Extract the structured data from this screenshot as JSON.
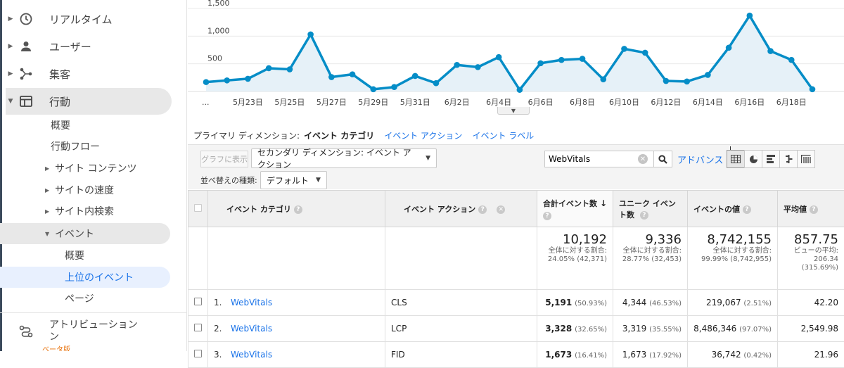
{
  "sidebar": {
    "top_items": [
      {
        "label": "リアルタイム",
        "icon": "clock-icon"
      },
      {
        "label": "ユーザー",
        "icon": "person-icon"
      },
      {
        "label": "集客",
        "icon": "acquisition-icon"
      },
      {
        "label": "行動",
        "icon": "behavior-icon"
      }
    ],
    "behavior_sub": [
      "概要",
      "行動フロー",
      "サイト コンテンツ",
      "サイトの速度",
      "サイト内検索",
      "イベント"
    ],
    "event_sub": [
      "概要",
      "上位のイベント",
      "ページ"
    ],
    "attribution_label": "アトリビューション",
    "attribution_label2": "ン",
    "beta_label": "ベータ版"
  },
  "chart": {
    "y_ticks": [
      "1,500",
      "1,000",
      "500"
    ],
    "x_ticks": [
      "...",
      "5月23日",
      "5月25日",
      "5月27日",
      "5月29日",
      "5月31日",
      "6月2日",
      "6月4日",
      "6月6日",
      "6月8日",
      "6月10日",
      "6月12日",
      "6月14日",
      "6月16日",
      "6月18日"
    ],
    "line_color": "#058dc7",
    "fill_color": "#e6f1f8"
  },
  "chart_data": {
    "type": "area",
    "ylim": [
      0,
      1500
    ],
    "x": [
      "5月21日",
      "5月22日",
      "5月23日",
      "5月24日",
      "5月25日",
      "5月26日",
      "5月27日",
      "5月28日",
      "5月29日",
      "5月30日",
      "5月31日",
      "6月1日",
      "6月2日",
      "6月3日",
      "6月4日",
      "6月5日",
      "6月6日",
      "6月7日",
      "6月8日",
      "6月9日",
      "6月10日",
      "6月11日",
      "6月12日",
      "6月13日",
      "6月14日",
      "6月15日",
      "6月16日",
      "6月17日",
      "6月18日",
      "6月19日"
    ],
    "values": [
      170,
      200,
      230,
      420,
      400,
      1030,
      260,
      310,
      40,
      80,
      280,
      150,
      480,
      440,
      620,
      30,
      510,
      570,
      590,
      220,
      770,
      700,
      190,
      180,
      300,
      790,
      1370,
      730,
      570,
      40
    ],
    "series": [
      {
        "values": [
          170,
          200,
          230,
          420,
          400,
          1030,
          260,
          310,
          40,
          80,
          280,
          150,
          480,
          440,
          620,
          30,
          510,
          570,
          590,
          220,
          770,
          700,
          190,
          180,
          300,
          790,
          1370,
          730,
          570,
          40
        ]
      }
    ]
  },
  "dimension": {
    "label": "プライマリ ディメンション:",
    "current": "イベント カテゴリ",
    "links": [
      "イベント アクション",
      "イベント ラベル"
    ]
  },
  "toolbar": {
    "plot_button": "グラフに表示",
    "secondary_dim": "セカンダリ ディメンション: イベント アクション",
    "search_value": "WebVitals",
    "advanced_label": "アドバンス",
    "sort_label": "並べ替えの種類:",
    "sort_value": "デフォルト"
  },
  "table": {
    "headers": [
      "イベント カテゴリ",
      "イベント アクション",
      "合計イベント数",
      "ユニーク イベント数",
      "イベントの値",
      "平均値"
    ],
    "totals": [
      {
        "value": "10,192",
        "sub1": "全体に対する割合:",
        "sub2": "24.05% (42,371)"
      },
      {
        "value": "9,336",
        "sub1": "全体に対する割合:",
        "sub2": "28.77% (32,453)"
      },
      {
        "value": "8,742,155",
        "sub1": "全体に対する割合:",
        "sub2": "99.99% (8,742,955)"
      },
      {
        "value": "857.75",
        "sub1": "ビューの平均:",
        "sub2": "206.34",
        "sub3": "(315.69%)"
      }
    ],
    "rows": [
      {
        "idx": "1.",
        "category": "WebVitals",
        "action": "CLS",
        "total": "5,191",
        "total_pct": "(50.93%)",
        "unique": "4,344",
        "unique_pct": "(46.53%)",
        "value": "219,067",
        "value_pct": "(2.51%)",
        "avg": "42.20"
      },
      {
        "idx": "2.",
        "category": "WebVitals",
        "action": "LCP",
        "total": "3,328",
        "total_pct": "(32.65%)",
        "unique": "3,319",
        "unique_pct": "(35.55%)",
        "value": "8,486,346",
        "value_pct": "(97.07%)",
        "avg": "2,549.98"
      },
      {
        "idx": "3.",
        "category": "WebVitals",
        "action": "FID",
        "total": "1,673",
        "total_pct": "(16.41%)",
        "unique": "1,673",
        "unique_pct": "(17.92%)",
        "value": "36,742",
        "value_pct": "(0.42%)",
        "avg": "21.96"
      }
    ]
  }
}
